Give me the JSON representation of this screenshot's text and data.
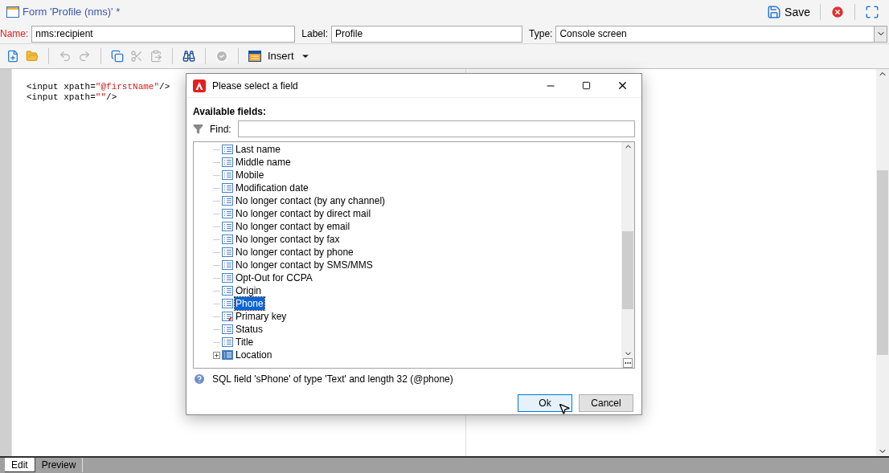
{
  "window": {
    "title": "Form 'Profile (nms)' *",
    "save": "Save"
  },
  "form": {
    "name_label": "Name:",
    "name_value": "nms:recipient",
    "label_label": "Label:",
    "label_value": "Profile",
    "type_label": "Type:",
    "type_value": "Console screen"
  },
  "toolbar": {
    "insert": "Insert"
  },
  "code_lines": [
    {
      "open": "<input xpath=",
      "value": "\"@firstName\"",
      "close": "/>"
    },
    {
      "open": "<input xpath=",
      "value": "\"\"",
      "close": "/>"
    }
  ],
  "dialog": {
    "title": "Please select a field",
    "section": "Available fields:",
    "find_label": "Find:",
    "fields": [
      {
        "label": "Last name",
        "kind": "field",
        "selected": false
      },
      {
        "label": "Middle name",
        "kind": "field",
        "selected": false
      },
      {
        "label": "Mobile",
        "kind": "field",
        "selected": false
      },
      {
        "label": "Modification date",
        "kind": "field",
        "selected": false
      },
      {
        "label": "No longer contact (by any channel)",
        "kind": "field",
        "selected": false
      },
      {
        "label": "No longer contact by direct mail",
        "kind": "field",
        "selected": false
      },
      {
        "label": "No longer contact by email",
        "kind": "field",
        "selected": false
      },
      {
        "label": "No longer contact by fax",
        "kind": "field",
        "selected": false
      },
      {
        "label": "No longer contact by phone",
        "kind": "field",
        "selected": false
      },
      {
        "label": "No longer contact by SMS/MMS",
        "kind": "field",
        "selected": false
      },
      {
        "label": "Opt-Out for CCPA",
        "kind": "field",
        "selected": false
      },
      {
        "label": "Origin",
        "kind": "field",
        "selected": false
      },
      {
        "label": "Phone",
        "kind": "field",
        "selected": true
      },
      {
        "label": "Primary key",
        "kind": "key",
        "selected": false
      },
      {
        "label": "Status",
        "kind": "field",
        "selected": false
      },
      {
        "label": "Title",
        "kind": "field",
        "selected": false
      },
      {
        "label": "Location",
        "kind": "link",
        "selected": false,
        "expanded": false
      }
    ],
    "info": "SQL field 'sPhone' of type 'Text' and length 32 (@phone)",
    "ok": "Ok",
    "cancel": "Cancel"
  },
  "tabs": [
    {
      "label": "Edit",
      "selected": true
    },
    {
      "label": "Preview",
      "selected": false
    }
  ]
}
